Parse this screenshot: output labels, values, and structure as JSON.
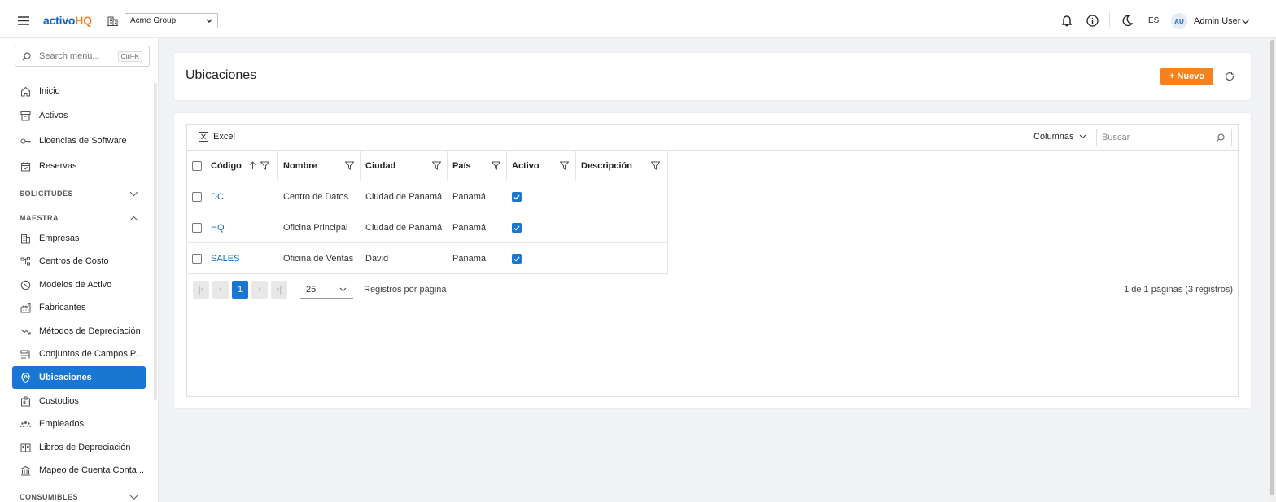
{
  "topbar": {
    "brand_main": "activo",
    "brand_accent": "HQ",
    "company": "Acme Group",
    "language": "ES",
    "avatar_initials": "AU",
    "user_name": "Admin User"
  },
  "sidebar": {
    "search_placeholder": "Search menu...",
    "search_shortcut": "Ctrl+K",
    "top_items": [
      {
        "label": "Inicio",
        "icon": "home-icon"
      },
      {
        "label": "Activos",
        "icon": "archive-icon"
      },
      {
        "label": "Licencias de Software",
        "icon": "key-icon"
      },
      {
        "label": "Reservas",
        "icon": "calendar-icon"
      }
    ],
    "section_solicitudes": "SOLICITUDES",
    "section_maestra": "MAESTRA",
    "maestra_items": [
      {
        "label": "Empresas",
        "icon": "building-icon"
      },
      {
        "label": "Centros de Costo",
        "icon": "org-chart-icon"
      },
      {
        "label": "Modelos de Activo",
        "icon": "model-icon"
      },
      {
        "label": "Fabricantes",
        "icon": "factory-icon"
      },
      {
        "label": "Métodos de Depreciación",
        "icon": "trend-down-icon"
      },
      {
        "label": "Conjuntos de Campos P...",
        "icon": "form-fields-icon"
      },
      {
        "label": "Ubicaciones",
        "icon": "location-pin-icon",
        "active": true
      },
      {
        "label": "Custodios",
        "icon": "id-badge-icon"
      },
      {
        "label": "Empleados",
        "icon": "users-icon"
      },
      {
        "label": "Libros de Depreciación",
        "icon": "book-icon"
      },
      {
        "label": "Mapeo de Cuenta Conta...",
        "icon": "bank-icon"
      }
    ],
    "section_consumibles": "CONSUMIBLES"
  },
  "header": {
    "title": "Ubicaciones",
    "new_button": "+ Nuevo"
  },
  "grid": {
    "excel_label": "Excel",
    "columns_label": "Columnas",
    "search_placeholder": "Buscar",
    "headers": [
      "Código",
      "Nombre",
      "Ciudad",
      "País",
      "Activo",
      "Descripción"
    ],
    "rows": [
      {
        "codigo": "DC",
        "nombre": "Centro de Datos",
        "ciudad": "Ciudad de Panamá",
        "pais": "Panamá",
        "activo": true,
        "descripcion": ""
      },
      {
        "codigo": "HQ",
        "nombre": "Oficina Principal",
        "ciudad": "Ciudad de Panamá",
        "pais": "Panamá",
        "activo": true,
        "descripcion": ""
      },
      {
        "codigo": "SALES",
        "nombre": "Oficina de Ventas",
        "ciudad": "David",
        "pais": "Panamá",
        "activo": true,
        "descripcion": ""
      }
    ],
    "pager": {
      "current_page": "1",
      "page_size": "25",
      "page_size_label": "Registros por página",
      "summary": "1 de 1 páginas (3 registros)"
    }
  },
  "colors": {
    "primary": "#1976d2",
    "accent": "#f5821f",
    "link": "#1565c0"
  }
}
